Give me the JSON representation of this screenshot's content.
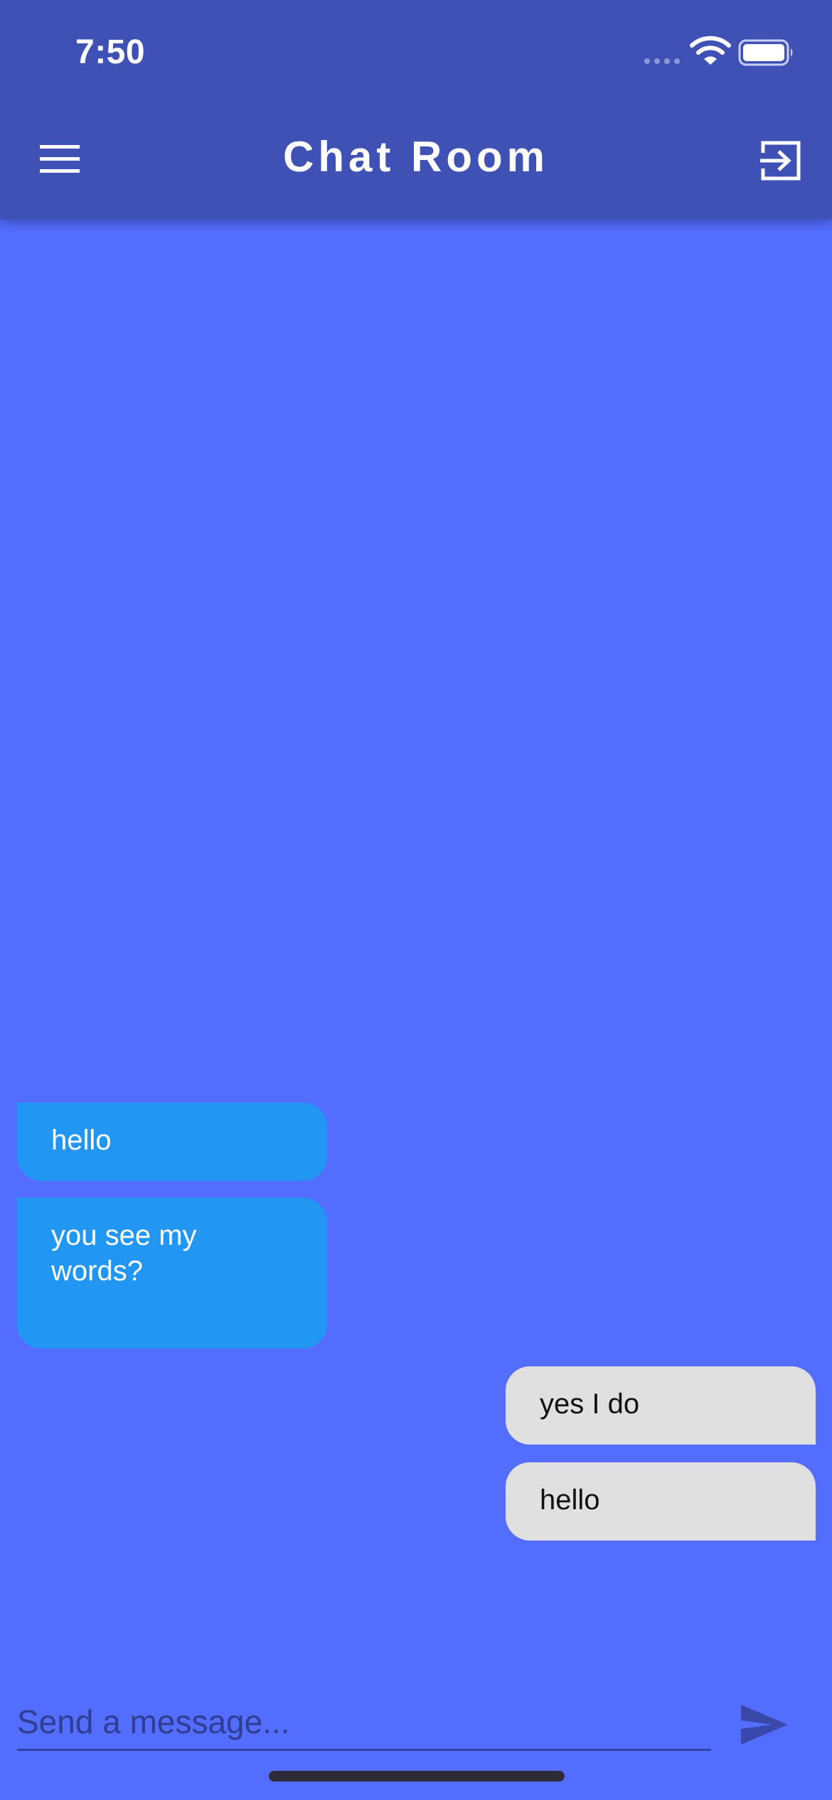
{
  "status_bar": {
    "time": "7:50"
  },
  "app_bar": {
    "title": "Chat Room",
    "menu_icon": "hamburger-menu-icon",
    "exit_icon": "exit-to-app-icon"
  },
  "messages": [
    {
      "text": "hello",
      "direction": "received"
    },
    {
      "text": "you see my words?",
      "direction": "received"
    },
    {
      "text": "yes I do",
      "direction": "sent"
    },
    {
      "text": "hello",
      "direction": "sent"
    }
  ],
  "composer": {
    "placeholder": "Send a message...",
    "value": "",
    "send_icon": "send-icon"
  },
  "colors": {
    "app_bar": "#3f51b5",
    "background": "#536dfe",
    "received_bubble": "#2196f3",
    "sent_bubble": "#e0e0e0",
    "send_icon": "#3949ab"
  }
}
